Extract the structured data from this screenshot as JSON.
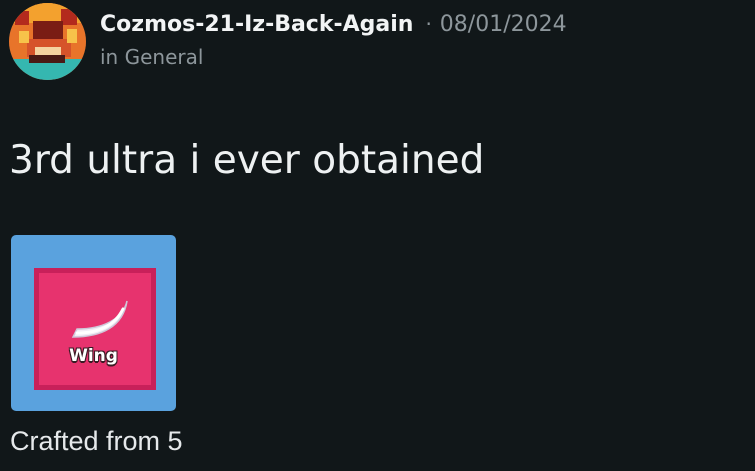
{
  "post": {
    "author": "Cozmos-21-Iz-Back-Again",
    "separator": "·",
    "date": "08/01/2024",
    "channel_prefix": "in",
    "channel": "General",
    "title": "3rd ultra i ever obtained",
    "caption": "Crafted from 5"
  },
  "attachment": {
    "label": "Wing",
    "icon": "wing-icon"
  },
  "colors": {
    "background": "#111719",
    "card": "#5aa2de",
    "item_tile": "#e7336e",
    "item_tile_border": "#c8205a",
    "muted_text": "#8d969b"
  }
}
